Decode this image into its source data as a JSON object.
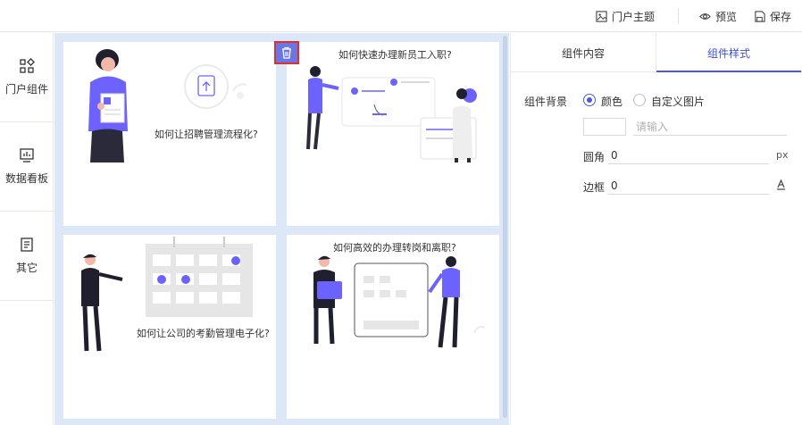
{
  "topbar": {
    "theme_label": "门户主题",
    "preview_label": "预览",
    "save_label": "保存"
  },
  "rail": {
    "items": [
      {
        "label": "门户组件",
        "icon": "component-grid-icon"
      },
      {
        "label": "数据看板",
        "icon": "dashboard-monitor-icon"
      },
      {
        "label": "其它",
        "icon": "document-list-icon"
      }
    ]
  },
  "canvas": {
    "cards": [
      {
        "question": "如何让招聘管理流程化?"
      },
      {
        "question": "如何快速办理新员工入职?"
      },
      {
        "question": "如何让公司的考勤管理电子化?"
      },
      {
        "question": "如何高效的办理转岗和离职?"
      }
    ]
  },
  "panel": {
    "tabs": [
      {
        "label": "组件内容",
        "active": false
      },
      {
        "label": "组件样式",
        "active": true
      }
    ],
    "background_label": "组件背景",
    "bg_option_color": "颜色",
    "bg_option_image": "自定义图片",
    "color_input_placeholder": "请输入",
    "radius_label": "圆角",
    "radius_value": "0",
    "radius_unit": "px",
    "border_label": "边框",
    "border_value": "0"
  },
  "colors": {
    "accent": "#4a5ad8",
    "illustration_purple": "#6c63ff",
    "canvas_bg": "#dce8f8",
    "highlight_red": "#e0302a"
  }
}
